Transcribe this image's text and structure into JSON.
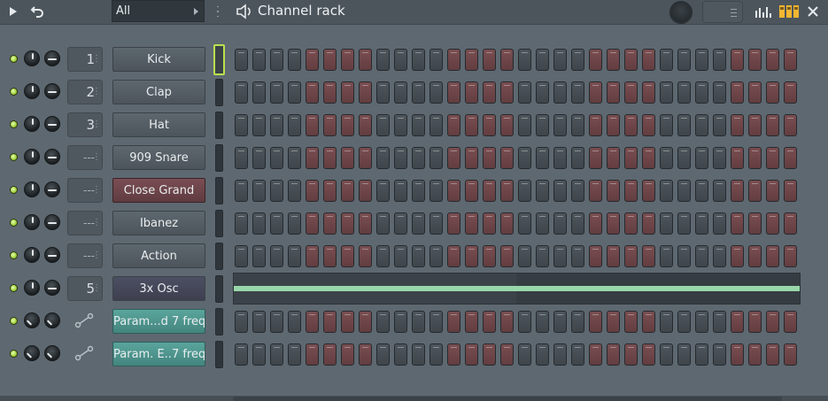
{
  "window": {
    "title": "Channel rack",
    "filter_value": "All"
  },
  "colors": {
    "led_on": "#9ed13a",
    "step_red": "#7a4e51",
    "step_gray": "#4d565c",
    "sampler_button": "#7a4e54",
    "automation_button": "#5aa59d",
    "note_green": "#98d7a9",
    "selected_outline": "#b9e14f"
  },
  "icons": {
    "play": "play-icon",
    "undo": "undo-icon",
    "speaker": "speaker-icon",
    "graph": "graph-editor-icon",
    "stepseq": "step-sequencer-icon",
    "close": "close-icon"
  },
  "step_pattern": [
    "g",
    "g",
    "g",
    "g",
    "r",
    "r",
    "r",
    "r",
    "g",
    "g",
    "g",
    "g",
    "r",
    "r",
    "r",
    "r",
    "g",
    "g",
    "g",
    "g",
    "r",
    "r",
    "r",
    "r",
    "g",
    "g",
    "g",
    "g",
    "r",
    "r",
    "r",
    "r"
  ],
  "channels": [
    {
      "name": "Kick",
      "track": "1",
      "type": "normal",
      "knobs": "normal",
      "selected": true,
      "view": "steps"
    },
    {
      "name": "Clap",
      "track": "2",
      "type": "normal",
      "knobs": "normal",
      "selected": false,
      "view": "steps"
    },
    {
      "name": "Hat",
      "track": "3",
      "type": "normal",
      "knobs": "normal",
      "selected": false,
      "view": "steps"
    },
    {
      "name": "909 Snare",
      "track": "---",
      "type": "normal",
      "knobs": "normal",
      "selected": false,
      "view": "steps"
    },
    {
      "name": "Close Grand",
      "track": "---",
      "type": "sampler",
      "knobs": "normal",
      "selected": false,
      "view": "steps"
    },
    {
      "name": "Ibanez",
      "track": "---",
      "type": "normal",
      "knobs": "normal",
      "selected": false,
      "view": "steps"
    },
    {
      "name": "Action",
      "track": "---",
      "type": "normal",
      "knobs": "normal",
      "selected": false,
      "view": "steps"
    },
    {
      "name": "3x Osc",
      "track": "5",
      "type": "synth",
      "knobs": "normal",
      "selected": false,
      "view": "pianoroll"
    },
    {
      "name": "Param...d 7 freq",
      "track": "",
      "type": "auto",
      "knobs": "auto",
      "selected": false,
      "view": "steps"
    },
    {
      "name": "Param. E..7 freq",
      "track": "",
      "type": "auto",
      "knobs": "auto",
      "selected": false,
      "view": "steps"
    }
  ]
}
